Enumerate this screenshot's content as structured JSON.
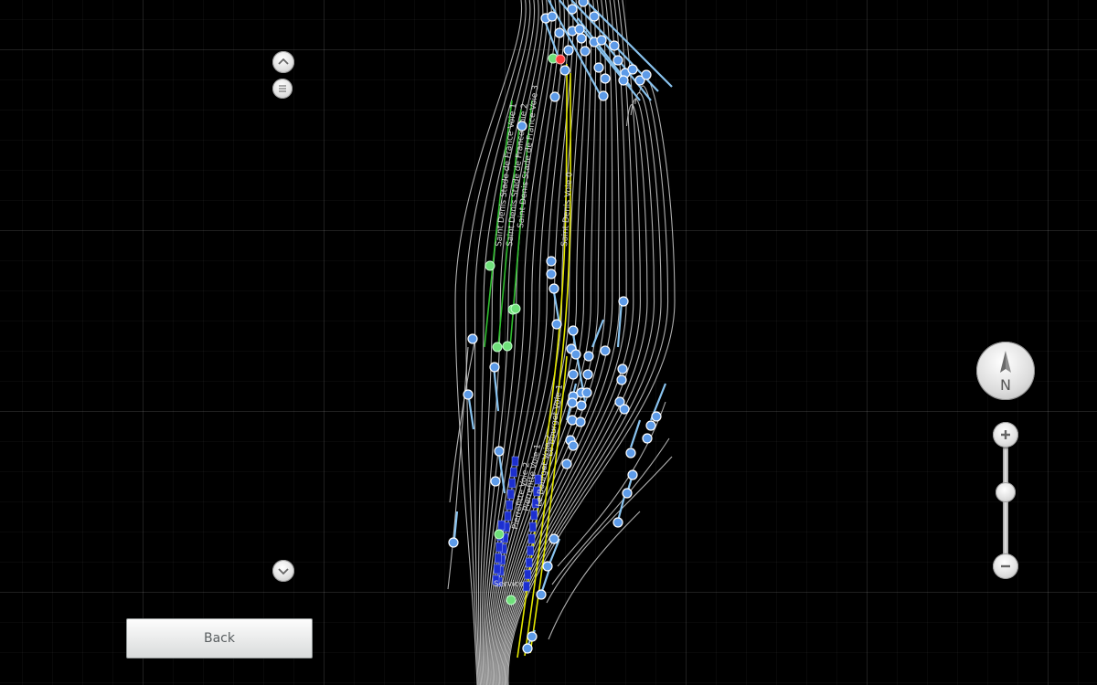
{
  "controls": {
    "back_label": "Back",
    "compass_label": "N"
  },
  "icons": {
    "scroll_up": "chevron-up-icon",
    "scroll_mid": "menu-lines-icon",
    "scroll_down": "chevron-down-icon",
    "zoom_in": "plus-icon",
    "zoom_out": "minus-icon",
    "compass": "north-arrow-icon"
  },
  "map": {
    "track_labels": [
      "Saint Denis Stade de France Voie 1",
      "Saint Denis Stade de France Voie 2",
      "Saint Denis Stade de France Voie 3",
      "Saint Denis Voie 0",
      "Pierrefitte Voie 2",
      "Pierrefitte Voie 1",
      "Le Bourget Voie 2",
      "Le Bourget Voie 1",
      "Service"
    ]
  },
  "colors": {
    "background": "#000000",
    "track_default": "#cfcfcf",
    "track_highlight_yellow": "#e3e600",
    "track_highlight_green": "#2fbf2f",
    "switch_segment": "#8ac4f0",
    "node_blue": "#5d9be8",
    "node_green": "#6fe07a",
    "node_red": "#ff3b3b",
    "train_blue": "#1c2fd0"
  }
}
